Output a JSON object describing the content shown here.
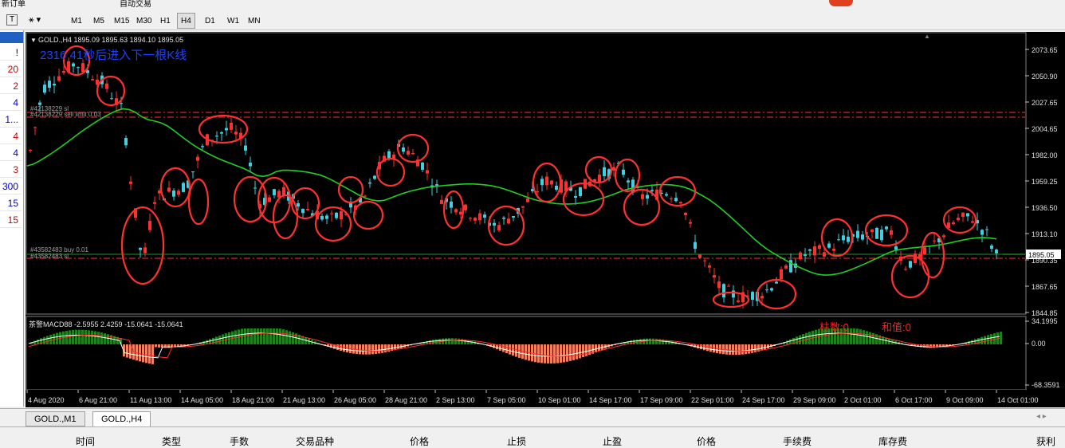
{
  "toolbar": {
    "top_partial_label": "新订单",
    "auto_trade_label": "自动交易",
    "timeframes": [
      "M1",
      "M5",
      "M15",
      "M30",
      "H1",
      "H4",
      "D1",
      "W1",
      "MN"
    ],
    "active_timeframe": "H4"
  },
  "left_panel": {
    "items": [
      "!",
      "20",
      "2",
      "4",
      "1...",
      "4",
      "4",
      "3",
      "300",
      "15",
      "15"
    ],
    "item_colors": [
      "#000000",
      "#cc0000",
      "#cc0000",
      "#0000cc",
      "#0000cc",
      "#cc0000",
      "#0000cc",
      "#cc0000",
      "#0000cc",
      "#0000cc",
      "#cc0000"
    ]
  },
  "chart": {
    "header": "GOLD.,H4  1895.09 1895.63 1894.10 1895.05",
    "countdown_text": "2316 41秒后进入下一根K线",
    "price_axis": [
      "2073.65",
      "2050.90",
      "2027.65",
      "2004.65",
      "1982.00",
      "1959.25",
      "1936.50",
      "1913.10",
      "1890.35",
      "1867.65",
      "1844.85"
    ],
    "current_price": "1895.05",
    "order_label_1a": "#42138229 sl",
    "order_label_1b": "#42138229 sell limit 0.03",
    "order_label_2a": "#43582483 buy 0.01",
    "order_label_2b": "#43582483 sl",
    "macd_header": "茶警MACD88 -2.5955 2.4259 -15.0641 -15.0641",
    "macd_axis": [
      "34.1995",
      "0.00",
      "-68.3591"
    ],
    "macd_bar_count_label": "柱数:0",
    "macd_sum_label": "和值:0",
    "time_axis": [
      "4 Aug 2020",
      "6 Aug 21:00",
      "11 Aug 13:00",
      "14 Aug 05:00",
      "18 Aug 21:00",
      "21 Aug 13:00",
      "26 Aug 05:00",
      "28 Aug 21:00",
      "2 Sep 13:00",
      "7 Sep 05:00",
      "10 Sep 01:00",
      "14 Sep 17:00",
      "17 Sep 09:00",
      "22 Sep 01:00",
      "24 Sep 17:00",
      "29 Sep 09:00",
      "2 Oct 01:00",
      "6 Oct 17:00",
      "9 Oct 09:00",
      "14 Oct 01:00"
    ],
    "colors": {
      "bull": "#ff3030",
      "bear": "#40d0e0",
      "ma": "#20d020",
      "macd_pos": "#208020",
      "macd_neg": "#f08060",
      "macd_signal": "#ff3030",
      "macd_line": "#ffffff"
    }
  },
  "tabs": [
    "GOLD.,M1",
    "GOLD.,H4"
  ],
  "active_tab": "GOLD.,H4",
  "terminal": {
    "columns": [
      "时间",
      "类型",
      "手数",
      "交易品种",
      "价格",
      "止损",
      "止盈",
      "价格",
      "手续费",
      "库存费",
      "获利"
    ]
  }
}
